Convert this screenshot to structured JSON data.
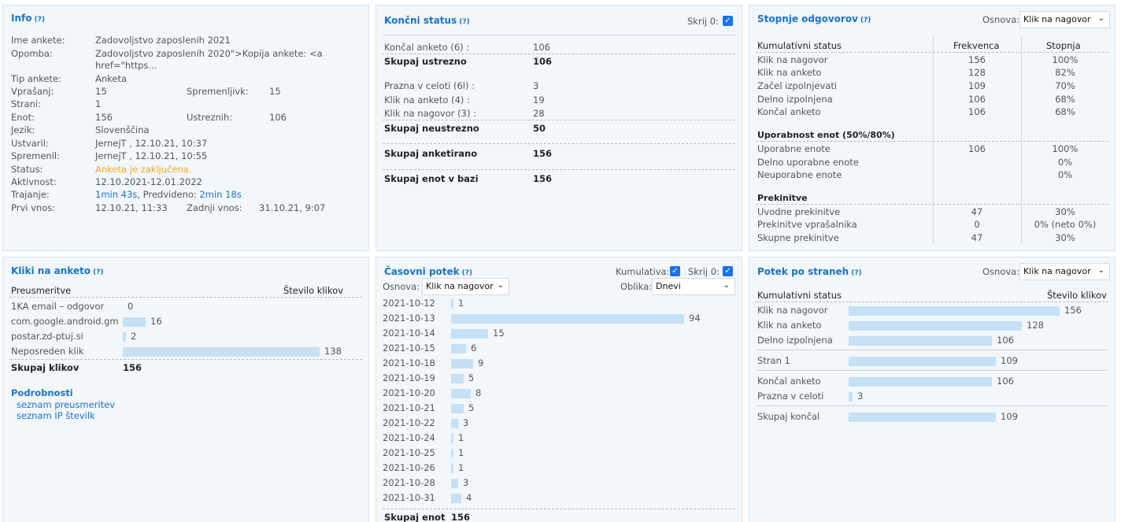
{
  "info": {
    "title": "Info",
    "help": "(?)",
    "rows": {
      "ime_lbl": "Ime ankete:",
      "ime_val": "Zadovoljstvo zaposlenih 2021",
      "opomba_lbl": "Opomba:",
      "opomba_val1": "Zadovoljstvo zaposlenih 2020\">Kopija ankete: <a",
      "opomba_val2": "href=\"https...",
      "tip_lbl": "Tip ankete:",
      "tip_val": "Anketa",
      "vpr_lbl": "Vprašanj:",
      "vpr_val": "15",
      "spr_lbl": "Spremenljivk:",
      "spr_val": "15",
      "strani_lbl": "Strani:",
      "strani_val": "1",
      "enot_lbl": "Enot:",
      "enot_val": "156",
      "ustr_lbl": "Ustreznih:",
      "ustr_val": "106",
      "jezik_lbl": "Jezik:",
      "jezik_val": "Slovenščina",
      "ustvaril_lbl": "Ustvaril:",
      "ustvaril_val": "JernejT , 12.10.21, 10:37",
      "spremenil_lbl": "Spremenil:",
      "spremenil_val": "JernejT , 12.10.21, 10:55",
      "status_lbl": "Status:",
      "status_val": "Anketa je zaključena.",
      "aktivnost_lbl": "Aktivnost:",
      "aktivnost_val": "12.10.2021-12.01.2022",
      "trajanje_lbl": "Trajanje:",
      "trajanje_val1": "1min 43s",
      "trajanje_sep": ", Predvideno: ",
      "trajanje_val2": "2min 18s",
      "prvi_lbl": "Prvi vnos:",
      "prvi_val": "12.10.21, 11:33",
      "zadnji_lbl": "Zadnji vnos:",
      "zadnji_val": "31.10.21, 9:07"
    }
  },
  "koncni": {
    "title": "Končni status",
    "help": "(?)",
    "skrij_label": "Skrij 0:",
    "rows": [
      {
        "label": "Končal anketo (6) :",
        "value": "106",
        "bold": false
      },
      {
        "label": "Skupaj ustrezno",
        "value": "106",
        "bold": true
      },
      {
        "label": "Prazna v celoti (6l) :",
        "value": "3",
        "bold": false
      },
      {
        "label": "Klik na anketo (4) :",
        "value": "19",
        "bold": false
      },
      {
        "label": "Klik na nagovor (3) :",
        "value": "28",
        "bold": false
      },
      {
        "label": "Skupaj neustrezno",
        "value": "50",
        "bold": true
      },
      {
        "label": "Skupaj anketirano",
        "value": "156",
        "bold": true
      },
      {
        "label": "Skupaj enot v bazi",
        "value": "156",
        "bold": true
      }
    ]
  },
  "stopnje": {
    "title": "Stopnje odgovorov",
    "help": "(?)",
    "osnova_label": "Osnova:",
    "osnova_value": "Klik na nagovor",
    "col1": "Kumulativni status",
    "col2": "Frekvenca",
    "col3": "Stopnja",
    "kum": [
      {
        "label": "Klik na nagovor",
        "freq": "156",
        "rate": "100%"
      },
      {
        "label": "Klik na anketo",
        "freq": "128",
        "rate": "82%"
      },
      {
        "label": "Začel izpolnjevati",
        "freq": "109",
        "rate": "70%"
      },
      {
        "label": "Delno izpolnjena",
        "freq": "106",
        "rate": "68%"
      },
      {
        "label": "Končal anketo",
        "freq": "106",
        "rate": "68%"
      }
    ],
    "upor_title": "Uporabnost enot (50%/80%)",
    "upor": [
      {
        "label": "Uporabne enote",
        "freq": "106",
        "rate": "100%"
      },
      {
        "label": "Delno uporabne enote",
        "freq": "",
        "rate": "0%"
      },
      {
        "label": "Neuporabne enote",
        "freq": "",
        "rate": "0%"
      }
    ],
    "prek_title": "Prekinitve",
    "prek": [
      {
        "label": "Uvodne prekinitve",
        "freq": "47",
        "rate": "30%"
      },
      {
        "label": "Prekinitve vprašalnika",
        "freq": "0",
        "rate": "0% (neto 0%)"
      },
      {
        "label": "Skupne prekinitve",
        "freq": "47",
        "rate": "30%"
      }
    ]
  },
  "kliki": {
    "title": "Kliki na anketo",
    "help": "(?)",
    "col1": "Preusmeritve",
    "col2": "Število klikov",
    "rows": [
      {
        "label": "1KA email – odgovor",
        "value": "0",
        "num": 0
      },
      {
        "label": "com.google.android.gm",
        "value": "16",
        "num": 16
      },
      {
        "label": "postar.zd-ptuj.si",
        "value": "2",
        "num": 2
      },
      {
        "label": "Neposreden klik",
        "value": "138",
        "num": 138
      }
    ],
    "total_label": "Skupaj klikov",
    "total_value": "156",
    "podrobnosti": "Podrobnosti",
    "link1": "seznam preusmeritev",
    "link2": "seznam IP številk"
  },
  "casovni": {
    "title": "Časovni potek",
    "help": "(?)",
    "kumulativa_label": "Kumulativa:",
    "skrij_label": "Skrij 0:",
    "osnova_label": "Osnova:",
    "osnova_value": "Klik na nagovor",
    "oblika_label": "Oblika:",
    "oblika_value": "Dnevi",
    "total_label": "Skupaj enot",
    "total_value": "156"
  },
  "potek": {
    "title": "Potek po straneh",
    "help": "(?)",
    "osnova_label": "Osnova:",
    "osnova_value": "Klik na nagovor",
    "col1": "Kumulativni status",
    "col2": "Število klikov",
    "rows": [
      {
        "label": "Klik na nagovor",
        "value": "156",
        "num": 156
      },
      {
        "label": "Klik na anketo",
        "value": "128",
        "num": 128
      },
      {
        "label": "Delno izpolnjena",
        "value": "106",
        "num": 106
      },
      {
        "label": "Stran 1",
        "value": "109",
        "num": 109
      },
      {
        "label": "Končal anketo",
        "value": "106",
        "num": 106
      },
      {
        "label": "Prazna v celoti",
        "value": "3",
        "num": 3
      },
      {
        "label": "Skupaj končal",
        "value": "109",
        "num": 109
      }
    ]
  },
  "chart_data": {
    "type": "bar",
    "categories": [
      "2021-10-12",
      "2021-10-13",
      "2021-10-14",
      "2021-10-15",
      "2021-10-18",
      "2021-10-19",
      "2021-10-20",
      "2021-10-21",
      "2021-10-22",
      "2021-10-24",
      "2021-10-25",
      "2021-10-26",
      "2021-10-28",
      "2021-10-31"
    ],
    "values": [
      1,
      94,
      15,
      6,
      9,
      5,
      8,
      5,
      3,
      1,
      1,
      1,
      3,
      4
    ],
    "title": "Časovni potek",
    "orientation": "horizontal"
  },
  "colors": {
    "accent": "#1a73c8",
    "bar": "#c6e0f5",
    "panel_bg": "#f2f7fc",
    "status": "#f5a623"
  }
}
